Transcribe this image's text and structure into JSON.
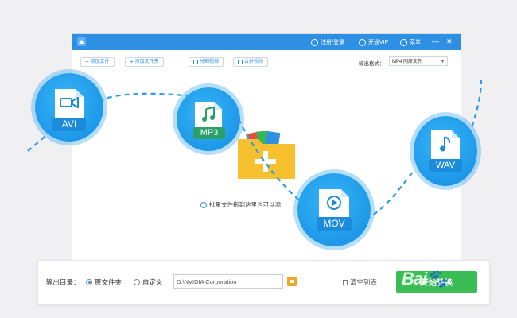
{
  "titlebar": {
    "login_label": "注册/登录",
    "vip_label": "开通VIP",
    "menu_label": "菜单",
    "minimize": "—",
    "close": "✕"
  },
  "toolbar": {
    "add_file_label": "添加文件",
    "add_folder_label": "添加文件夹",
    "split_video_label": "分割视频",
    "merge_video_label": "合并视频",
    "output_format_label": "输出格式：",
    "output_format_value": "MP4  同原文件"
  },
  "main": {
    "drop_hint": "批量文件拖到这里也可以添"
  },
  "bottom": {
    "output_dir_label": "输出目录：",
    "radio_original": "原文件夹",
    "radio_custom": "自定义",
    "path_value": "D:\\NVIDIA Corporation",
    "clear_list_label": "清空列表",
    "start_label": "开始转换"
  },
  "badges": [
    {
      "label": "AVI",
      "icon": "video-camera-icon"
    },
    {
      "label": "MP3",
      "icon": "music-note-icon"
    },
    {
      "label": "MOV",
      "icon": "play-icon"
    },
    {
      "label": "WAV",
      "icon": "music-note-icon"
    }
  ],
  "colors": {
    "brand_blue": "#2f8fe3",
    "badge_blue": "#1e98e9",
    "start_green": "#3bbd55",
    "folder_yellow": "#f7c02f"
  }
}
